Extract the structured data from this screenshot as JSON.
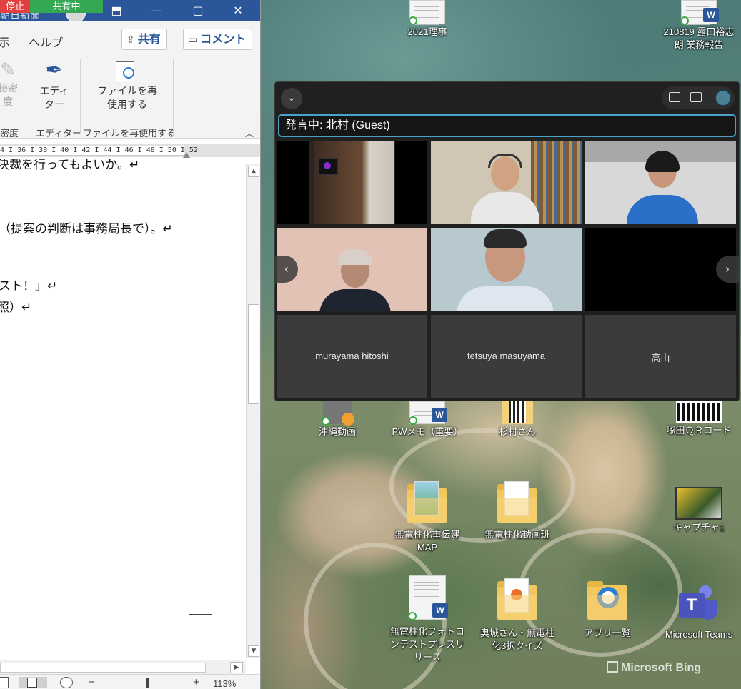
{
  "word": {
    "share_stop": "停止",
    "share_active": "共有中",
    "title_fragment": "朝日新聞",
    "menu": {
      "view": "示",
      "help": "ヘルプ"
    },
    "share_button": "共有",
    "comment_button": "コメント",
    "ribbon": {
      "sensitivity_btn_top": "秘密",
      "sensitivity_btn_bottom": "度",
      "sensitivity_group": "密度",
      "editor_btn_top": "エディ",
      "editor_btn_bottom": "ター",
      "editor_group": "エディター",
      "reuse_btn_top": "ファイルを再",
      "reuse_btn_bottom": "使用する",
      "reuse_group": "ファイルを再使用する"
    },
    "ruler_text": "4 I 36 I 38 I 40 I 42 I 44 I 46 I  48 I 50 I 52",
    "doc_lines": [
      "決裁を行ってもよいか。↵",
      "（提案の判断は事務局長で）。↵",
      "スト！」↵",
      "照）↵"
    ],
    "zoom": "113%",
    "zoom_minus": "−",
    "zoom_plus": "+"
  },
  "meeting": {
    "speaker": "発言中: 北村 (Guest)",
    "participants": [
      "murayama hitoshi",
      "tetsuya masuyama",
      "高山"
    ],
    "nav_prev": "‹",
    "nav_next": "›"
  },
  "desktop": {
    "icons": [
      "2021理事",
      "210819 露口裕志朗 業務報告",
      "沖縄動画",
      "PWメモ（重要）",
      "杉村さん",
      "塚田ＱＲコード",
      "無電柱化重伝建MAP",
      "無電柱化動画班",
      "キャプチャ1",
      "無電柱化フォトコンテストプレスリリース",
      "奥城さん・無電柱化3択クイズ",
      "アプリ一覧",
      "Microsoft Teams"
    ],
    "bing": "Microsoft Bing"
  }
}
